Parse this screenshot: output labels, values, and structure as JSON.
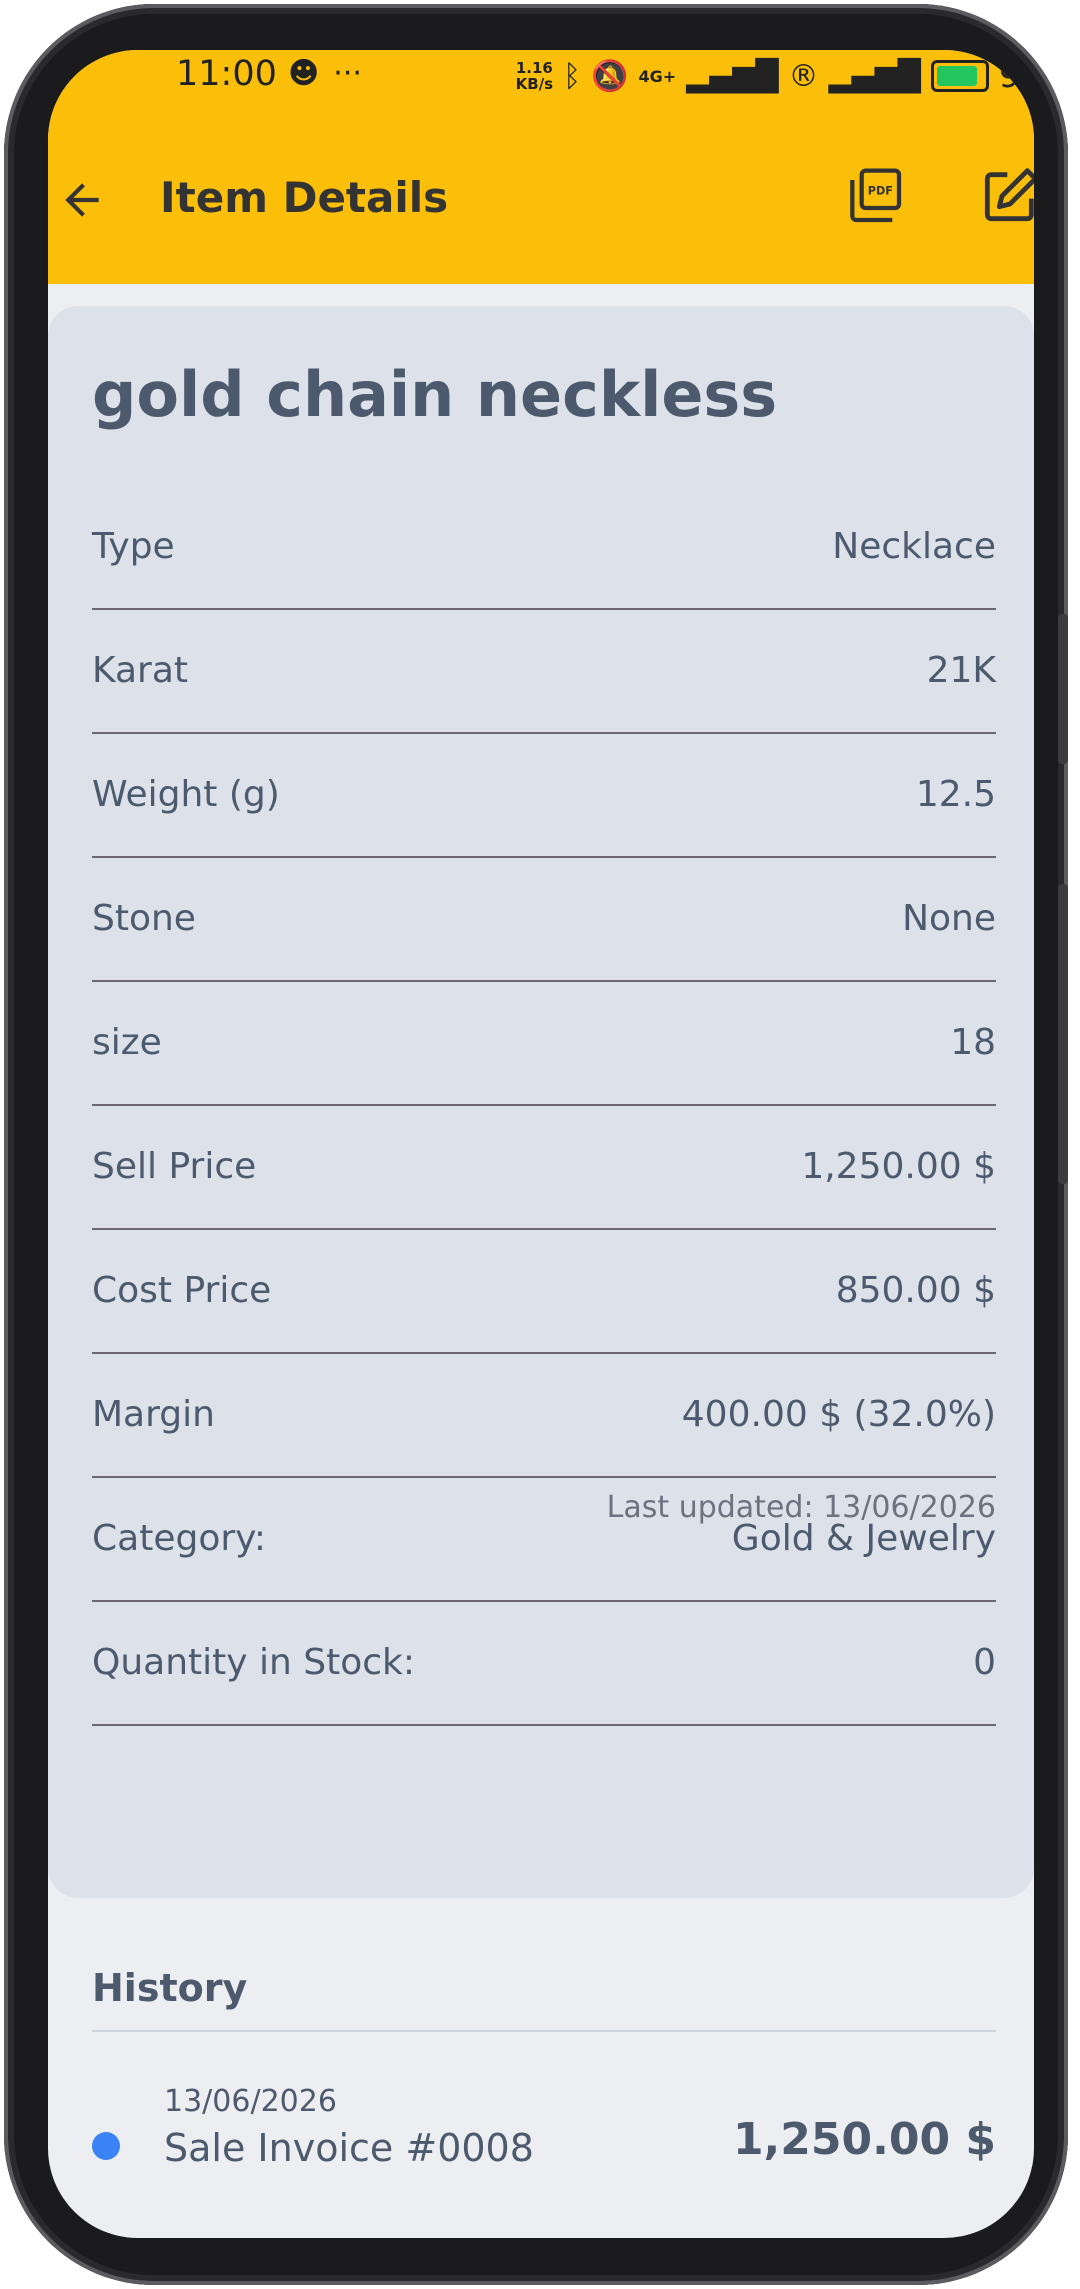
{
  "status_bar": {
    "time": "11:00",
    "net_speed_top": "1.16",
    "net_speed_bottom": "KB/s",
    "network": "4G+",
    "battery": "95"
  },
  "app_bar": {
    "title": "Item Details",
    "back_icon": "arrow-left-icon",
    "pdf_icon": "pdf-icon",
    "edit_icon": "edit-icon",
    "color": "#fbbf09"
  },
  "item": {
    "name": "gold chain neckless",
    "details": [
      {
        "label": "Type",
        "value": "Necklace"
      },
      {
        "label": "Karat",
        "value": "21K"
      },
      {
        "label": "Weight (g)",
        "value": "12.5"
      },
      {
        "label": "Stone",
        "value": "None"
      },
      {
        "label": "size",
        "value": "18"
      },
      {
        "label": "Sell Price",
        "value": "1,250.00 $"
      },
      {
        "label": "Cost Price",
        "value": "850.00 $"
      },
      {
        "label": "Margin",
        "value": "400.00 $ (32.0%)"
      },
      {
        "label": "Category:",
        "value": "Gold & Jewelry"
      },
      {
        "label": "Quantity in Stock:",
        "value": "0"
      }
    ],
    "last_updated": "Last updated: 13/06/2026"
  },
  "history": {
    "title": "History",
    "entries": [
      {
        "date": "13/06/2026",
        "label": "Sale Invoice #0008",
        "amount": "1,250.00 $",
        "dot_color": "#3b82f6"
      }
    ]
  }
}
